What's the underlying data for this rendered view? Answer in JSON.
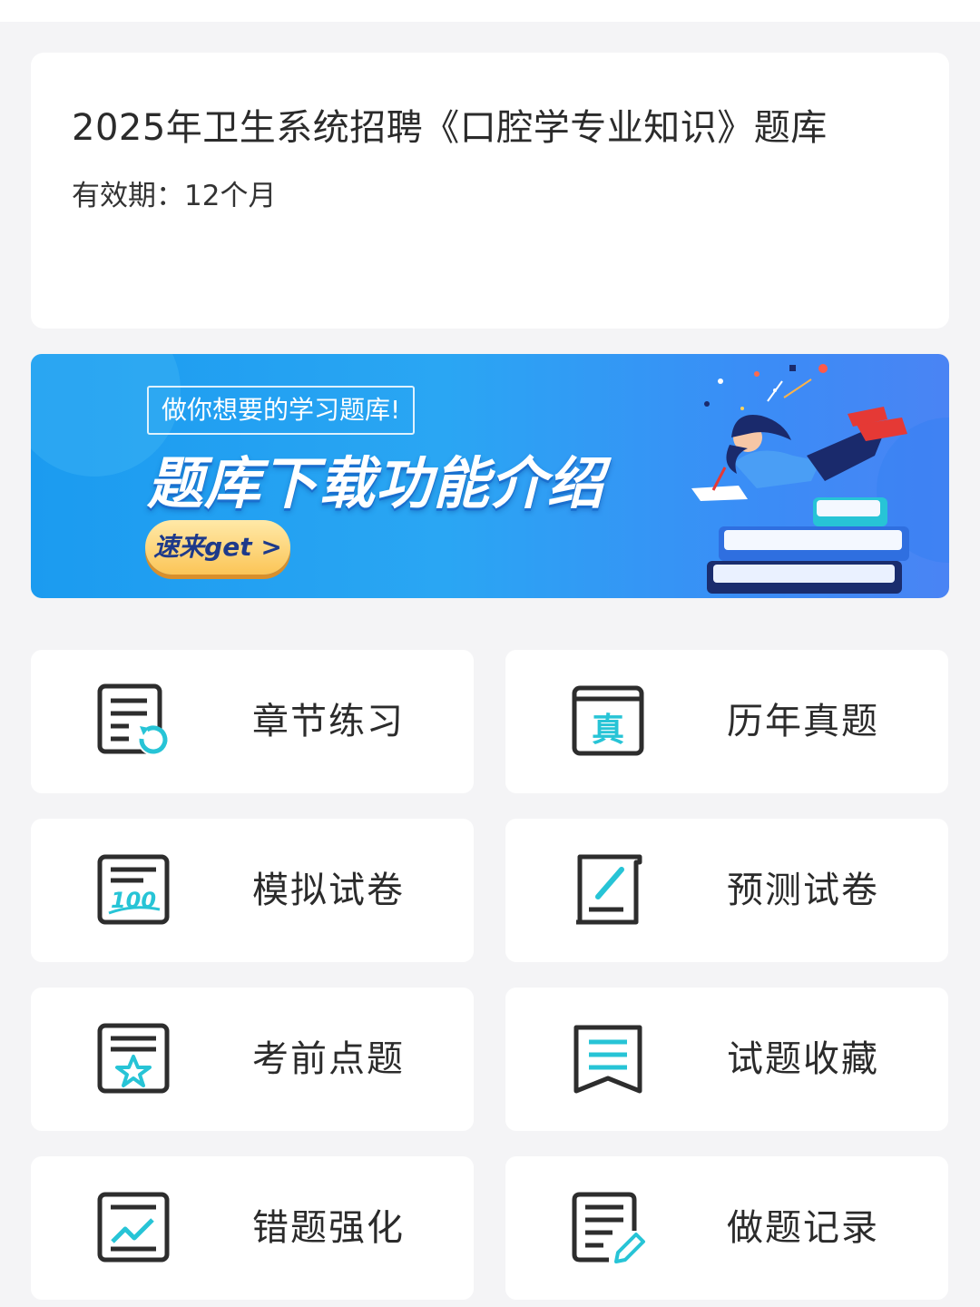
{
  "course": {
    "title": "2025年卫生系统招聘《口腔学专业知识》题库",
    "validity": "有效期：12个月"
  },
  "banner": {
    "tag": "做你想要的学习题库!",
    "headline": "题库下载功能介绍",
    "cta": "速来get >"
  },
  "menu": [
    {
      "label": "章节练习",
      "icon": "chapter-practice-icon"
    },
    {
      "label": "历年真题",
      "icon": "past-exams-icon"
    },
    {
      "label": "模拟试卷",
      "icon": "mock-paper-icon"
    },
    {
      "label": "预测试卷",
      "icon": "forecast-paper-icon"
    },
    {
      "label": "考前点题",
      "icon": "pre-exam-tips-icon"
    },
    {
      "label": "试题收藏",
      "icon": "favorites-icon"
    },
    {
      "label": "错题强化",
      "icon": "wrong-questions-icon"
    },
    {
      "label": "做题记录",
      "icon": "practice-record-icon"
    }
  ],
  "colors": {
    "accent": "#27c4d6",
    "icon_stroke": "#2d2d2d",
    "banner_blue": "#2aa6f3",
    "background": "#f4f4f6"
  }
}
